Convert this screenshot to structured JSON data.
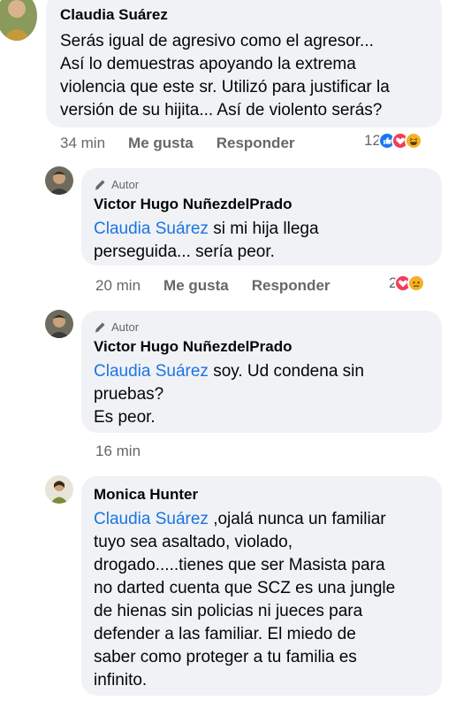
{
  "comments": [
    {
      "author": "Claudia Suárez",
      "lines": [
        "Serás igual de agresivo como el agresor...",
        "Así lo demuestras apoyando la extrema",
        "violencia  que este sr. Utilizó para justificar la",
        "versión de su hijita... Así de violento serás?"
      ],
      "time": "34 min",
      "like_label": "Me gusta",
      "reply_label": "Responder",
      "reaction_count": "12",
      "reactions": [
        "like-icon",
        "love-icon",
        "haha-icon"
      ]
    },
    {
      "badge": "Autor",
      "author": "Victor Hugo NuñezdelPrado",
      "mention": "Claudia Suárez",
      "line1_rest": " si mi hija llega",
      "line2": "perseguida... sería peor.",
      "time": "20 min",
      "like_label": "Me gusta",
      "reply_label": "Responder",
      "reaction_count": "2",
      "reactions": [
        "love-icon",
        "sad-icon"
      ]
    },
    {
      "badge": "Autor",
      "author": "Victor Hugo NuñezdelPrado",
      "mention": "Claudia Suárez",
      "line1_rest": " soy.   Ud condena sin",
      "line2": "pruebas?",
      "line3": "Es peor.",
      "time": "16 min"
    },
    {
      "author": "Monica Hunter",
      "mention": "Claudia Suárez",
      "line1_rest": " ,ojalá nunca un familiar",
      "lines": [
        "tuyo sea asaltado, violado,",
        "drogado.....tienes que ser Masista para",
        "no darted cuenta que SCZ es una jungle",
        "de hienas sin policias ni jueces para",
        "defender a las familiar. El miedo de",
        "saber como proteger a tu familia es",
        "infinito."
      ]
    }
  ],
  "colors": {
    "bubble": "#f0f2f5",
    "mention": "#1b74e4",
    "meta": "#65676b",
    "like": "#1877f2",
    "love": "#f33e58",
    "haha": "#f7b125"
  }
}
